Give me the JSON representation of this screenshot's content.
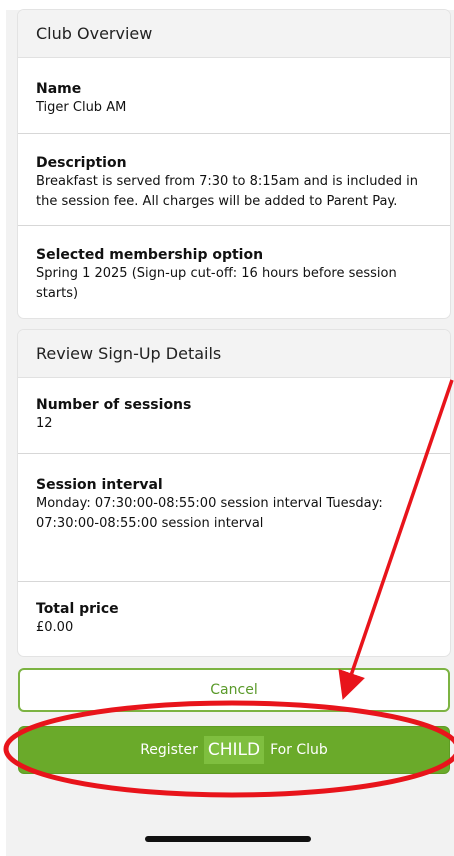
{
  "club_overview": {
    "header": "Club Overview",
    "name_label": "Name",
    "name_value": "Tiger Club AM",
    "description_label": "Description",
    "description_line1": "Breakfast is served from 7:30 to 8:15am and is included in",
    "description_line2": "the session fee. All charges will be added to Parent Pay.",
    "membership_label": "Selected membership option",
    "membership_line1": "Spring 1 2025 (Sign-up cut-off: 16 hours before session",
    "membership_line2": "starts)"
  },
  "review": {
    "header": "Review Sign-Up Details",
    "sessions_label": "Number of sessions",
    "sessions_value": "12",
    "interval_label": "Session interval",
    "interval_line1": "Monday: 07:30:00-08:55:00 session interval Tuesday:",
    "interval_line2": "07:30:00-08:55:00 session interval",
    "price_label": "Total price",
    "price_value": "£0.00"
  },
  "buttons": {
    "cancel_label": "Cancel",
    "register_prefix": "Register",
    "register_child": "CHILD",
    "register_suffix": "For Club"
  },
  "colors": {
    "accent_green": "#6aaa2a",
    "annotation_red": "#e8141b"
  }
}
